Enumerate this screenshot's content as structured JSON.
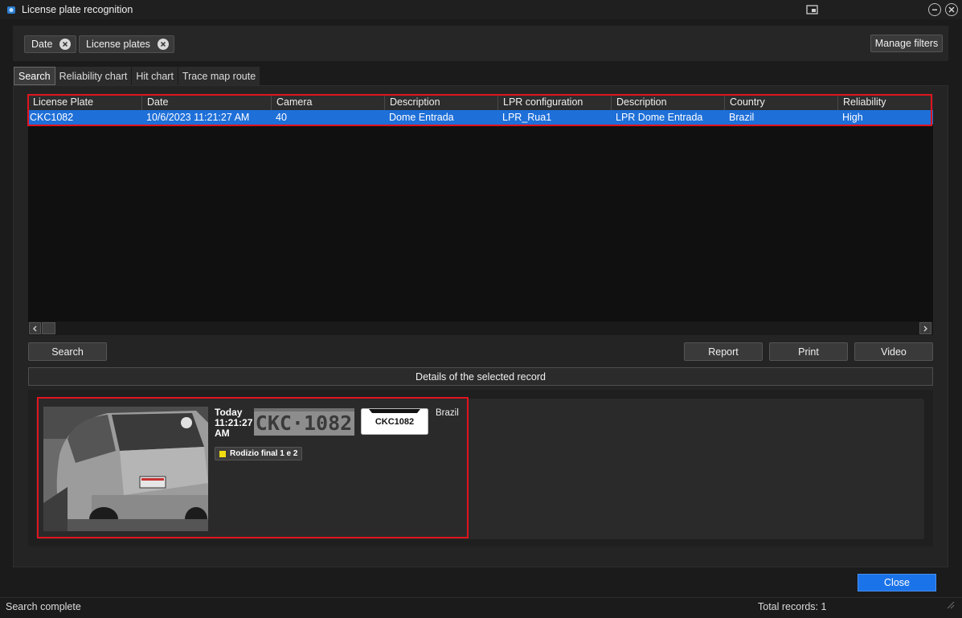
{
  "window": {
    "title": "License plate recognition",
    "icon": "camera-app-icon"
  },
  "filters": {
    "chips": [
      {
        "label": "Date"
      },
      {
        "label": "License plates"
      }
    ],
    "manage_label": "Manage filters"
  },
  "tabs": [
    {
      "label": "Search",
      "active": true
    },
    {
      "label": "Reliability chart"
    },
    {
      "label": "Hit chart"
    },
    {
      "label": "Trace map route"
    }
  ],
  "table": {
    "columns": [
      "License Plate",
      "Date",
      "Camera",
      "Description",
      "LPR configuration",
      "Description",
      "Country",
      "Reliability"
    ],
    "rows": [
      [
        "CKC1082",
        "10/6/2023 11:21:27 AM",
        "40",
        "Dome Entrada",
        "LPR_Rua1",
        "LPR Dome Entrada",
        "Brazil",
        "High"
      ]
    ]
  },
  "actions": {
    "search": "Search",
    "report": "Report",
    "print": "Print",
    "video": "Video"
  },
  "details": {
    "header": "Details of the selected record",
    "day": "Today",
    "time_line1": "11:21:27",
    "time_line2": "AM",
    "plate_badge": "CKC1082",
    "plate_crop_text": "CKC·1082",
    "country": "Brazil",
    "list_tag": "Rodizio final 1 e 2",
    "list_tag_color": "#f2dd10"
  },
  "footer": {
    "close_label": "Close",
    "status": "Search complete",
    "total": "Total records: 1"
  },
  "colors": {
    "accent": "#1a73e8",
    "selection": "#1e6fd8",
    "highlight": "#e0141e"
  }
}
